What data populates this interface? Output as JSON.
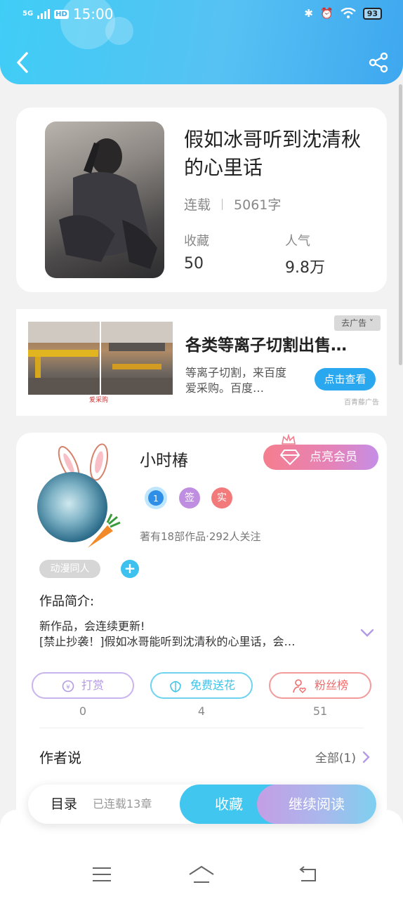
{
  "status_bar": {
    "network": "5G",
    "hd": "HD",
    "time": "15:00",
    "battery": "93"
  },
  "header": {
    "back_icon": "chevron-left-icon",
    "share_icon": "share-icon"
  },
  "book": {
    "title": "假如冰哥听到沈清秋的心里话",
    "status": "连载",
    "word_count": "5061字",
    "favorites_label": "收藏",
    "favorites_value": "50",
    "popularity_label": "人气",
    "popularity_value": "9.8万"
  },
  "ad": {
    "close_label": "去广告",
    "title": "各类等离子切割出售…",
    "description": "等离子切割，来百度爱采购。百度…",
    "button_label": "点击查看",
    "logo_text": "爱采购",
    "source": "百青藤广告"
  },
  "author": {
    "name": "小时椿",
    "vip_button": "点亮会员",
    "badges": [
      "签",
      "实"
    ],
    "stats": "著有18部作品·292人关注",
    "tag": "动漫同人",
    "tag_add": "+"
  },
  "intro": {
    "title": "作品简介:",
    "line1": "新作品，会连续更新!",
    "line2": "[禁止抄袭！]假如冰哥能听到沈清秋的心里话，会…"
  },
  "actions": [
    {
      "label": "打赏",
      "count": "0",
      "color": "#b49ae6",
      "icon": "coin-icon"
    },
    {
      "label": "免费送花",
      "count": "4",
      "color": "#3fc3e8",
      "icon": "flower-icon"
    },
    {
      "label": "粉丝榜",
      "count": "51",
      "color": "#f06b6b",
      "icon": "user-heart-icon"
    }
  ],
  "author_says": {
    "title": "作者说",
    "all_link": "全部(1)"
  },
  "bottom_bar": {
    "toc": "目录",
    "chapters": "已连载13章",
    "favorite": "收藏",
    "continue": "继续阅读"
  },
  "nav": {
    "menu_icon": "menu-icon",
    "home_icon": "home-icon",
    "back_icon": "back-icon"
  },
  "colors": {
    "accent_blue": "#40c6ef",
    "vip_pink": "#f57e8e",
    "purple": "#b49ae6"
  }
}
